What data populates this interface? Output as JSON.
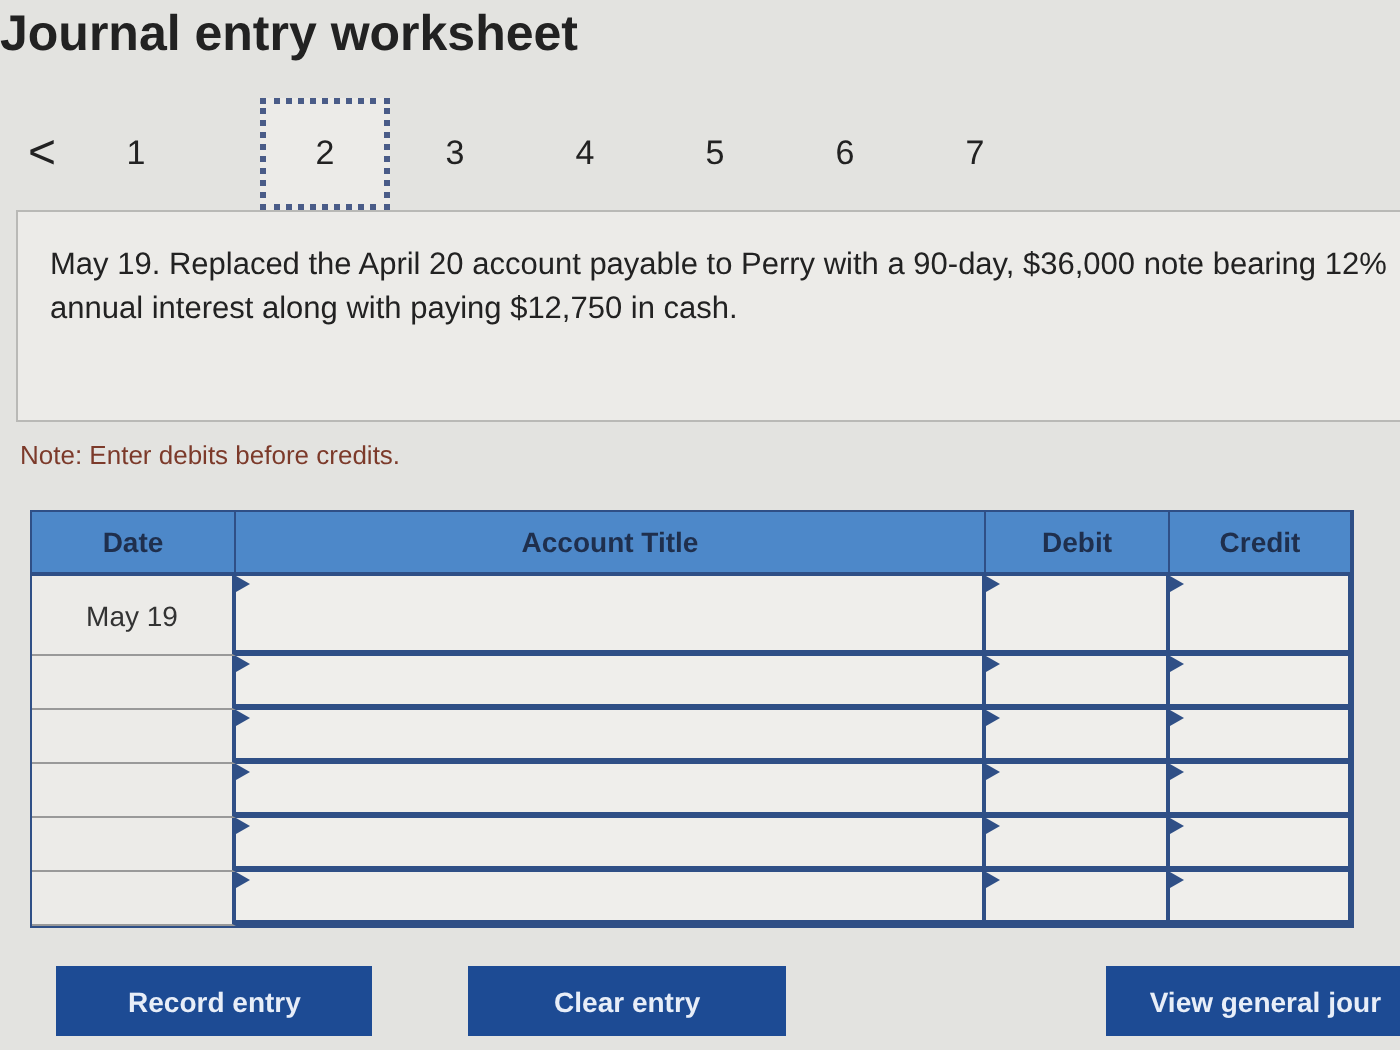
{
  "title": "Journal entry worksheet",
  "pager": {
    "prev": "<",
    "pages": [
      {
        "label": "1",
        "selected": false
      },
      {
        "label": "2",
        "selected": true
      },
      {
        "label": "3",
        "selected": false
      },
      {
        "label": "4",
        "selected": false
      },
      {
        "label": "5",
        "selected": false
      },
      {
        "label": "6",
        "selected": false
      },
      {
        "label": "7",
        "selected": false
      }
    ]
  },
  "question": "May 19. Replaced the April 20 account payable to Perry with a 90-day, $36,000 note bearing 12% annual interest along with paying $12,750 in cash.",
  "note": "Note: Enter debits before credits.",
  "table": {
    "columns": [
      "Date",
      "Account Title",
      "Debit",
      "Credit"
    ],
    "rows": [
      {
        "date": "May 19"
      },
      {},
      {},
      {},
      {},
      {}
    ]
  },
  "buttons": [
    "Record entry",
    "Clear entry",
    "View general jour"
  ]
}
